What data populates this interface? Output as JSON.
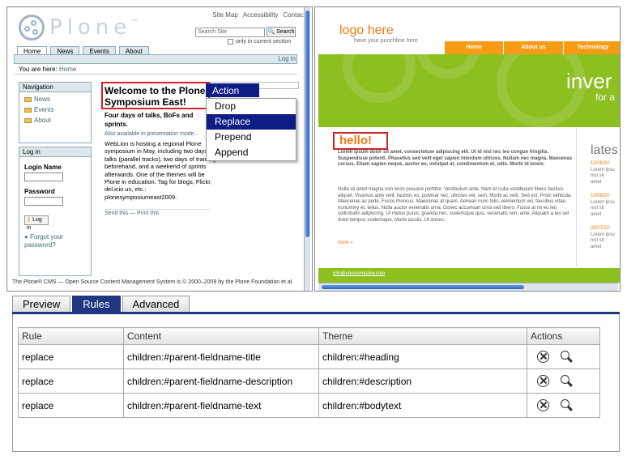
{
  "plone": {
    "logo": "Plone",
    "tm": "™",
    "toplinks": [
      "Site Map",
      "Accessibility",
      "Contact"
    ],
    "search_placeholder": "Search Site",
    "search_button": "Search",
    "only_in_section": "only in current section",
    "tabs": [
      "Home",
      "News",
      "Events",
      "About"
    ],
    "login_link": "Log in",
    "you_are_here": "You are here:",
    "breadcrumb_home": "Home",
    "navigation_title": "Navigation",
    "nav_items": [
      "News",
      "Events",
      "About"
    ],
    "login_title": "Log in",
    "login_name_label": "Login Name",
    "password_label": "Password",
    "login_button": "Log in",
    "forgot": "Forgot your password?",
    "heading": "Welcome to the Plone Symposium East!",
    "description": "Four days of talks, BoFs and sprints.",
    "also_available": "Also available in presentation mode...",
    "bodytext": "WebLion is hosting a regional Plone symposium in May, including two days of talks (parallel tracks), two days of training beforehand, and a weekend of sprints afterwards. One of the themes will be Plone in education. Tag for blogs, Flickr, del.icio.us, etc.: plonesymposiumeast2009.",
    "send_this": "Send this",
    "print_this": "Print this",
    "footer": "The Plone® CMS — Open Source Content Management System is © 2000–2009 by the Plone Foundation et al."
  },
  "action_menu": {
    "title": "Action",
    "items": [
      "Drop",
      "Replace",
      "Prepend",
      "Append"
    ],
    "selected": "Replace"
  },
  "theme": {
    "logo": "logo here",
    "punchline": "have your punchline here",
    "nav": [
      "Home",
      "About us",
      "Technology"
    ],
    "hero_word": "inver",
    "hero_sub": "for a",
    "hello": "hello!",
    "para1": "Lorem ipsum dolor sit amet, consectetuer adipiscing elit. Ut id nisl nec leo congue fringilla. Suspendisse potenti. Phasellus sed velit eget sapien interdum ultrices. Nullam nec magna. Maecenas cursus. Etiam sapien neque, auctor eu, volutpat at, condimentum et, odio. Morbi id lorem.",
    "para2": "Nulla sit amet magna non enim posuere porttitor. Vestibulum ante. Nam et nulla vestibulum libero facilisis aliquet. Vivamus ante velit, facilisis eu, pulvinar nec, ultricies vel, sem. Morbi ac velit. Sed est. Proin vehicula. Maecenas ac pede. Fusce rhoncus. Maecenas at quam. Aenean nunc felis, elementum vel, faucibus vitae, nonummy et, tellus. Nulla auctor venenatis urna. Donec accumsan urna sed libero. Fusce at mi eu leo sollicitudin adipiscing. Ut metus purus, gravida nec, scelerisque quis, venenatis non, ante. Aliquam a leo vel dolor tempus scelerisque. Morbi iaculis. Ut donec.",
    "more": "more »",
    "latest": "lates",
    "side_items": [
      {
        "date": "12/08/20",
        "text": [
          "Lorem ipsu",
          "nisl sit",
          "amet"
        ]
      },
      {
        "date": "10/08/20",
        "text": [
          "Lorem ipsu",
          "nisl sit",
          "amet"
        ]
      },
      {
        "date": "28/07/20",
        "text": [
          "Lorem ipsu",
          "nisl sit",
          "amet"
        ]
      }
    ],
    "email": "info@yourcompany.com"
  },
  "panel": {
    "tabs": [
      "Preview",
      "Rules",
      "Advanced"
    ],
    "active_tab": "Rules",
    "columns": [
      "Rule",
      "Content",
      "Theme",
      "Actions"
    ],
    "rows": [
      {
        "rule": "replace",
        "content": "children:#parent-fieldname-title",
        "theme": "children:#heading"
      },
      {
        "rule": "replace",
        "content": "children:#parent-fieldname-description",
        "theme": "children:#description"
      },
      {
        "rule": "replace",
        "content": "children:#parent-fieldname-text",
        "theme": "children:#bodytext"
      }
    ]
  },
  "colors": {
    "accent_navy": "#1f3680",
    "menu_navy": "#0f1c85",
    "highlight_red": "#d0222a",
    "theme_orange": "#f07a12",
    "theme_green": "#8cbf20"
  }
}
